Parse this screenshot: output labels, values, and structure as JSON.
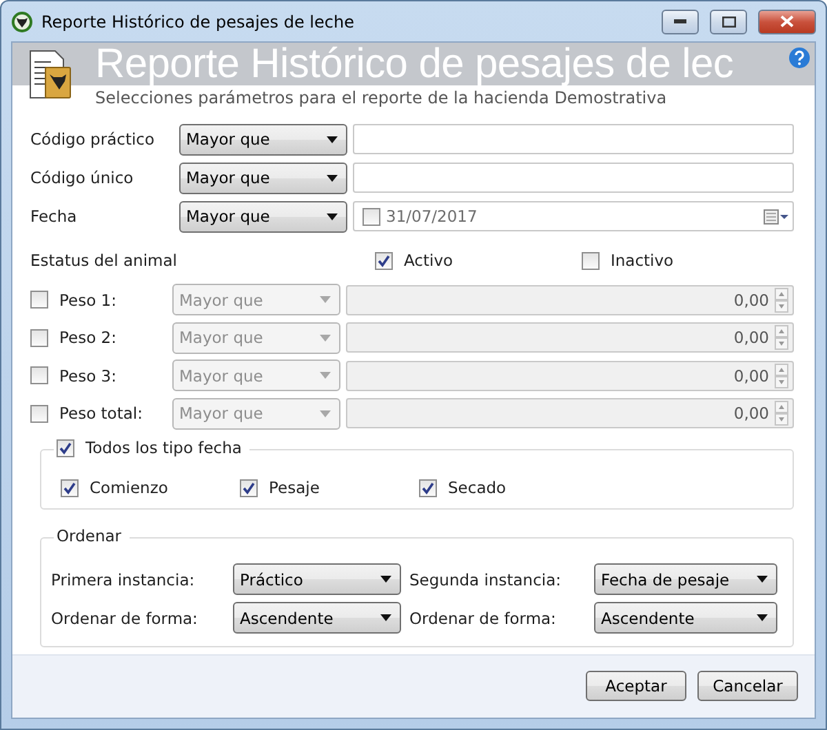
{
  "window": {
    "title": "Reporte Histórico de pesajes de leche"
  },
  "header": {
    "title": "Reporte Histórico de pesajes de lec",
    "subtitle": "Selecciones parámetros para el reporte de la hacienda Demostrativa"
  },
  "filters": [
    {
      "kind": "text",
      "label": "Código práctico",
      "operator": "Mayor que"
    },
    {
      "kind": "text",
      "label": "Código único",
      "operator": "Mayor que"
    },
    {
      "kind": "date",
      "label": "Fecha",
      "operator": "Mayor que",
      "date_checked": false,
      "date": "31/07/2017"
    }
  ],
  "status": {
    "label": "Estatus del animal",
    "options": [
      {
        "label": "Activo",
        "checked": true
      },
      {
        "label": "Inactivo",
        "checked": false
      }
    ]
  },
  "weights": [
    {
      "label": "Peso 1:",
      "checked": false,
      "operator": "Mayor que",
      "value": "0,00"
    },
    {
      "label": "Peso 2:",
      "checked": false,
      "operator": "Mayor que",
      "value": "0,00"
    },
    {
      "label": "Peso 3:",
      "checked": false,
      "operator": "Mayor que",
      "value": "0,00"
    },
    {
      "label": "Peso total:",
      "checked": false,
      "operator": "Mayor que",
      "value": "0,00"
    }
  ],
  "date_types": {
    "label": "Todos los tipo fecha",
    "checked": true,
    "options": [
      {
        "label": "Comienzo",
        "checked": true
      },
      {
        "label": "Pesaje",
        "checked": true
      },
      {
        "label": "Secado",
        "checked": true
      }
    ]
  },
  "order": {
    "title": "Ordenar",
    "fields": [
      {
        "label": "Primera instancia:",
        "value": "Práctico"
      },
      {
        "label": "Segunda instancia:",
        "value": "Fecha de pesaje"
      },
      {
        "label": "Ordenar de forma:",
        "value": "Ascendente"
      },
      {
        "label": "Ordenar de forma:",
        "value": "Ascendente"
      }
    ]
  },
  "buttons": [
    "Aceptar",
    "Cancelar"
  ]
}
